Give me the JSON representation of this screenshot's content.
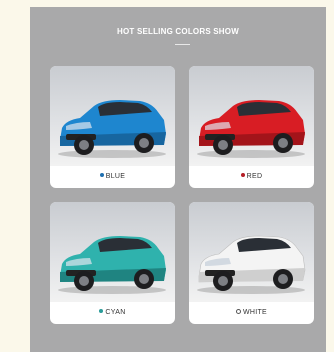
{
  "section": {
    "title": "HOT SELLING COLORS SHOW"
  },
  "cards": [
    {
      "label": "BLUE",
      "dot_color": "#1f6fb0",
      "car_color": "#1e86cf",
      "car_shade": "#1766a0"
    },
    {
      "label": "RED",
      "dot_color": "#b51f26",
      "car_color": "#d81d24",
      "car_shade": "#a3141a"
    },
    {
      "label": "CYAN",
      "dot_color": "#2a9c99",
      "car_color": "#2fb2ad",
      "car_shade": "#1f8481"
    },
    {
      "label": "WHITE",
      "dot_color": "#ffffff",
      "car_color": "#f4f4f4",
      "car_shade": "#cfcfcf"
    }
  ]
}
